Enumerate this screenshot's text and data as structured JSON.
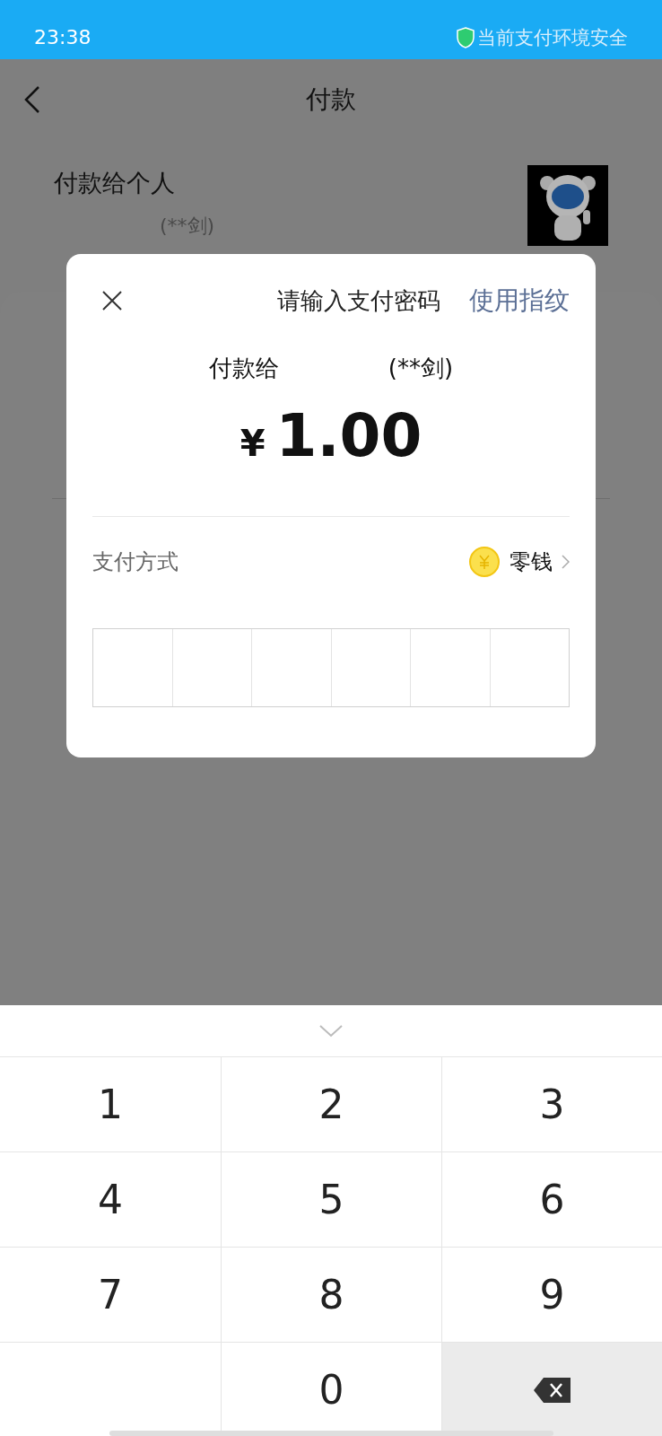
{
  "status_bar": {
    "time": "23:38",
    "security": "当前支付环境安全"
  },
  "header": {
    "title": "付款"
  },
  "payee": {
    "heading": "付款给个人",
    "name": "(**剑)"
  },
  "dialog": {
    "title": "请输入支付密码",
    "fingerprint_link": "使用指纹",
    "pay_to": "付款给",
    "payee_name": "(**剑)",
    "currency": "¥",
    "amount": "1.00",
    "method_label": "支付方式",
    "method_value": "零钱"
  },
  "keypad": [
    {
      "kind": "digit",
      "label": "1"
    },
    {
      "kind": "digit",
      "label": "2"
    },
    {
      "kind": "digit",
      "label": "3"
    },
    {
      "kind": "digit",
      "label": "4"
    },
    {
      "kind": "digit",
      "label": "5"
    },
    {
      "kind": "digit",
      "label": "6"
    },
    {
      "kind": "digit",
      "label": "7"
    },
    {
      "kind": "digit",
      "label": "8"
    },
    {
      "kind": "digit",
      "label": "9"
    },
    {
      "kind": "blank"
    },
    {
      "kind": "digit",
      "label": "0"
    },
    {
      "kind": "backspace"
    }
  ]
}
